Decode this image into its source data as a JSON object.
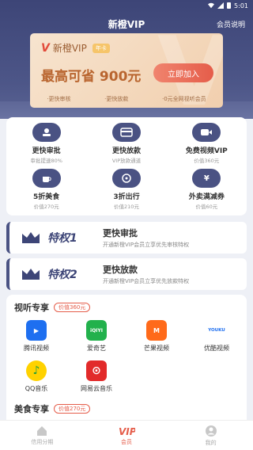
{
  "status_bar": {
    "time": "5:01"
  },
  "nav": {
    "title": "新橙VIP",
    "right_link": "会员说明"
  },
  "vip_card": {
    "logo": "V",
    "name": "新橙VIP",
    "tag": "年卡",
    "save_text": "最高可省 900元",
    "join_button": "立即加入",
    "benefits": [
      "·更快审核",
      "·更快放款",
      "·0元全网视听会员"
    ]
  },
  "features": [
    {
      "title": "更快审批",
      "subtitle": "审批提速80%",
      "icon": "stamp-icon"
    },
    {
      "title": "更快放款",
      "subtitle": "VIP放款通道",
      "icon": "card-icon"
    },
    {
      "title": "免费视频VIP",
      "subtitle": "价值360元",
      "icon": "video-icon"
    },
    {
      "title": "5折美食",
      "subtitle": "价值270元",
      "icon": "coffee-icon"
    },
    {
      "title": "3折出行",
      "subtitle": "价值210元",
      "icon": "wheel-icon"
    },
    {
      "title": "外卖满减券",
      "subtitle": "价值60元",
      "icon": "coupon-icon"
    }
  ],
  "privileges": [
    {
      "label": "特权1",
      "title": "更快审批",
      "desc": "开通新橙VIP会员立享优先审核特权"
    },
    {
      "label": "特权2",
      "title": "更快放款",
      "desc": "开通新橙VIP会员立享优先放款特权"
    }
  ],
  "media_section": {
    "title": "视听专享",
    "tag": "价值360元",
    "apps": [
      {
        "label": "腾讯视频",
        "icon": "tencent-video-icon",
        "color": "#1e6ff0",
        "mark": "▶"
      },
      {
        "label": "爱奇艺",
        "icon": "iqiyi-icon",
        "color": "#22b14c",
        "mark": "iQIYI"
      },
      {
        "label": "芒果视频",
        "icon": "mango-icon",
        "color": "#ff6a1a",
        "mark": "M"
      },
      {
        "label": "优酷视频",
        "icon": "youku-icon",
        "color": "#ffffff",
        "mark": "YOUKU"
      },
      {
        "label": "QQ音乐",
        "icon": "qq-music-icon",
        "color": "#ffd200",
        "mark": "♪"
      },
      {
        "label": "网易云音乐",
        "icon": "netease-music-icon",
        "color": "#e22a2a",
        "mark": "⊙"
      }
    ]
  },
  "food_section": {
    "title": "美食专享",
    "tag": "价值270元"
  },
  "tabbar": [
    {
      "label": "信用分期",
      "icon": "home-icon",
      "active": false
    },
    {
      "label": "会员",
      "icon": "vip-icon",
      "active": true
    },
    {
      "label": "我的",
      "icon": "profile-icon",
      "active": false
    }
  ],
  "colors": {
    "primary": "#4a5283",
    "accent": "#e55d4a",
    "gold": "#b9652f"
  }
}
